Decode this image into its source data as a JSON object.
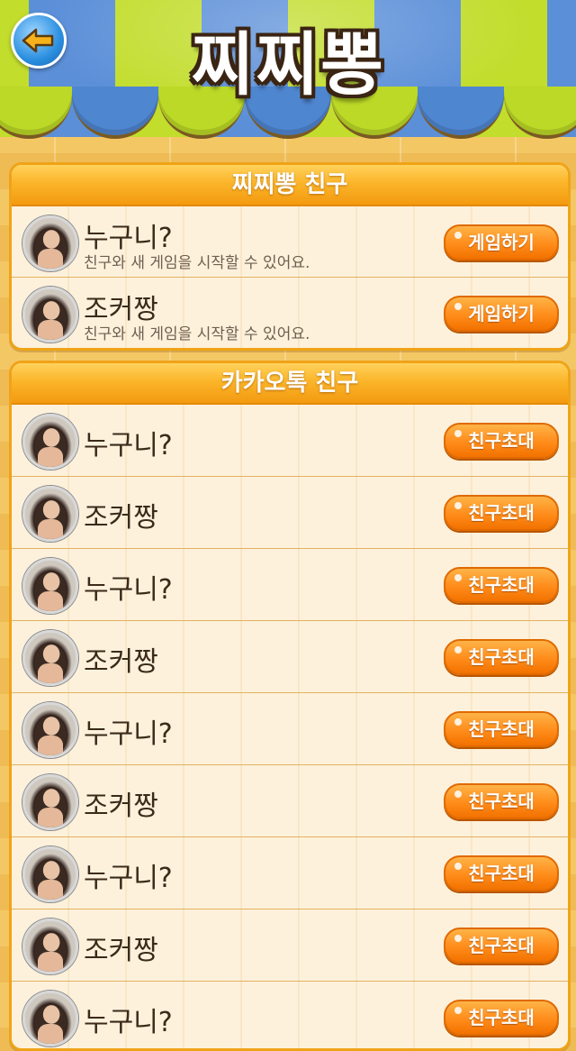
{
  "header": {
    "title": "찌찌뽕",
    "back_icon": "back-arrow-icon"
  },
  "sections": [
    {
      "title": "찌찌뽕 친구",
      "rows": [
        {
          "name": "누구니?",
          "desc": "친구와 새 게임을 시작할 수 있어요.",
          "button": "게임하기"
        },
        {
          "name": "조커짱",
          "desc": "친구와 새 게임을 시작할 수 있어요.",
          "button": "게임하기"
        }
      ]
    },
    {
      "title": "카카오톡 친구",
      "rows": [
        {
          "name": "누구니?",
          "button": "친구초대"
        },
        {
          "name": "조커짱",
          "button": "친구초대"
        },
        {
          "name": "누구니?",
          "button": "친구초대"
        },
        {
          "name": "조커짱",
          "button": "친구초대"
        },
        {
          "name": "누구니?",
          "button": "친구초대"
        },
        {
          "name": "조커짱",
          "button": "친구초대"
        },
        {
          "name": "누구니?",
          "button": "친구초대"
        },
        {
          "name": "조커짱",
          "button": "친구초대"
        },
        {
          "name": "누구니?",
          "button": "친구초대"
        }
      ]
    }
  ],
  "colors": {
    "accent": "#f39a10",
    "button": "#ff8c1a",
    "awning_green": "#c2dd2c",
    "awning_blue": "#5b8fd8"
  }
}
